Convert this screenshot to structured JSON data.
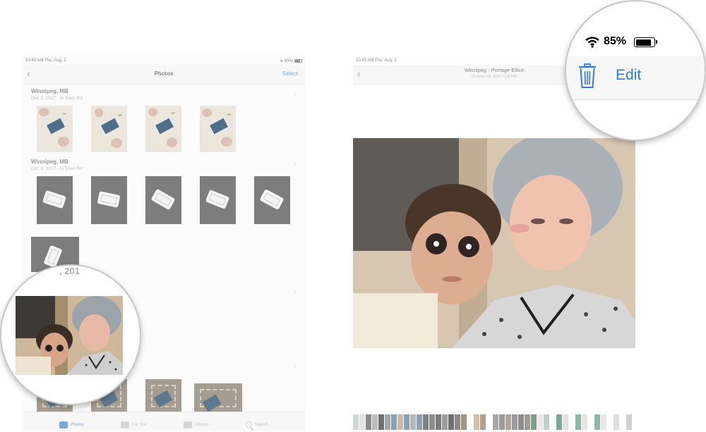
{
  "left_panel": {
    "status": {
      "time": "10:43 AM  Thu. Aug. 2",
      "battery": "85%"
    },
    "nav": {
      "back_icon": "chevron-left-icon",
      "title": "Photos",
      "select_label": "Select"
    },
    "sections": [
      {
        "place": "Winnipeg, MB",
        "meta": "Oct. 2, 2017  ·  N Town Rd"
      },
      {
        "place": "Winnipeg, MB",
        "meta": "Oct. 6, 2017  ·  N Town Rd"
      }
    ],
    "magnifier_date_fragment": ", 201",
    "tabs": [
      {
        "label": "Photos",
        "icon": "photos-icon",
        "active": true
      },
      {
        "label": "For You",
        "icon": "for-you-icon",
        "active": false
      },
      {
        "label": "Albums",
        "icon": "albums-icon",
        "active": false
      },
      {
        "label": "Search",
        "icon": "search-icon",
        "active": false
      }
    ]
  },
  "right_panel": {
    "status": {
      "time": "10:43 AM  Thu. Aug. 2"
    },
    "nav": {
      "back_icon": "chevron-left-icon",
      "title": "Winnipeg - Portage-Ellice",
      "subtitle": "October 28, 2017  7:25 PM"
    },
    "magnifier": {
      "battery_percent": "85%",
      "edit_label": "Edit",
      "trash_icon": "trash-icon",
      "wifi_icon": "wifi-icon"
    }
  },
  "colors": {
    "accent": "#2e7be0",
    "accent_faded": "#7aa7e0"
  }
}
